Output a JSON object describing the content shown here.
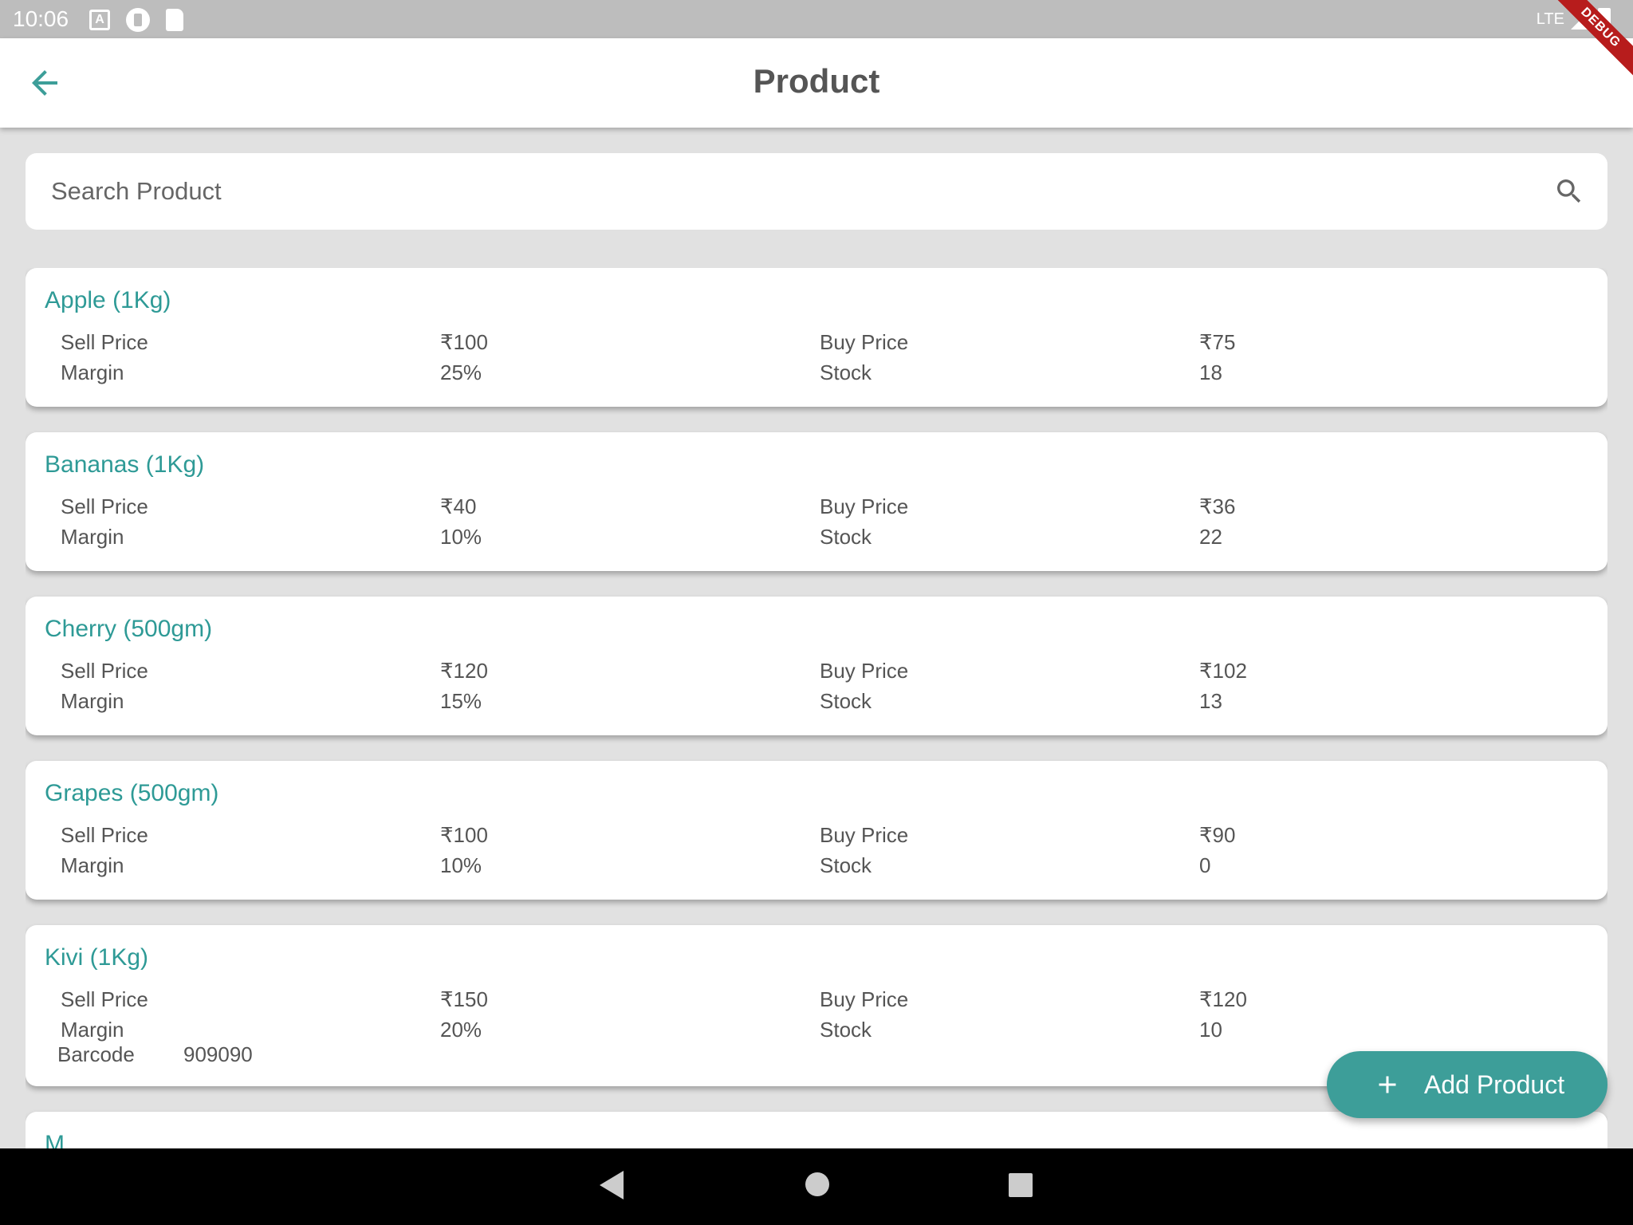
{
  "status_bar": {
    "time": "10:06",
    "network": "LTE",
    "icons": [
      "notification-a-icon",
      "notification-circle-icon",
      "sd-card-icon",
      "signal-icon",
      "battery-icon"
    ],
    "debug_banner": "DEBUG"
  },
  "app_bar": {
    "title": "Product",
    "back_icon": "arrow-left-icon"
  },
  "search": {
    "placeholder": "Search Product",
    "value": "",
    "icon": "search-icon"
  },
  "labels": {
    "sell_price": "Sell Price",
    "buy_price": "Buy Price",
    "margin": "Margin",
    "stock": "Stock",
    "barcode": "Barcode"
  },
  "products": [
    {
      "name": "Apple (1Kg)",
      "sell_price": "₹100",
      "buy_price": "₹75",
      "margin": "25%",
      "stock": "18"
    },
    {
      "name": "Bananas (1Kg)",
      "sell_price": "₹40",
      "buy_price": "₹36",
      "margin": "10%",
      "stock": "22"
    },
    {
      "name": "Cherry (500gm)",
      "sell_price": "₹120",
      "buy_price": "₹102",
      "margin": "15%",
      "stock": "13"
    },
    {
      "name": "Grapes (500gm)",
      "sell_price": "₹100",
      "buy_price": "₹90",
      "margin": "10%",
      "stock": "0"
    },
    {
      "name": "Kivi (1Kg)",
      "sell_price": "₹150",
      "buy_price": "₹120",
      "margin": "20%",
      "stock": "10",
      "barcode": "909090"
    },
    {
      "name": "M"
    }
  ],
  "fab": {
    "label": "Add Product",
    "icon": "plus-icon"
  },
  "colors": {
    "accent": "#3d9e99",
    "product_name": "#2e9a96",
    "background": "#e1e1e1",
    "status_bar": "#bdbdbd",
    "debug_ribbon": "#b71c1c"
  }
}
